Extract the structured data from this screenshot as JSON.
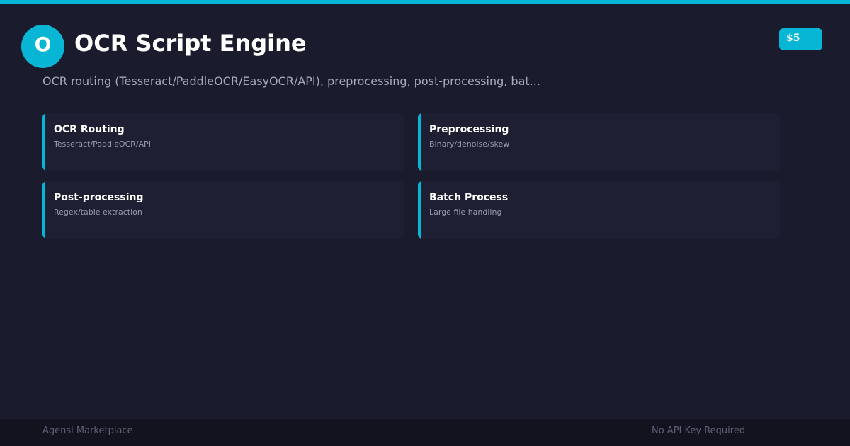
{
  "header": {
    "logo_letter": "O",
    "title": "OCR Script Engine",
    "price": "$5",
    "subtitle": "OCR routing (Tesseract/PaddleOCR/EasyOCR/API), preprocessing, post-processing, bat..."
  },
  "features": [
    {
      "title": "OCR Routing",
      "description": "Tesseract/PaddleOCR/API"
    },
    {
      "title": "Preprocessing",
      "description": "Binary/denoise/skew"
    },
    {
      "title": "Post-processing",
      "description": "Regex/table extraction"
    },
    {
      "title": "Batch Process",
      "description": "Large file handling"
    }
  ],
  "footer": {
    "brand": "Agensi Marketplace",
    "note": "No API Key Required"
  },
  "colors": {
    "accent": "#06b6d4",
    "background": "#1b1b2e",
    "card": "#1f1f33",
    "footer": "#13131f"
  }
}
